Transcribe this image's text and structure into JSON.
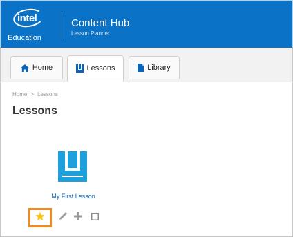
{
  "header": {
    "logo_word": "intel",
    "logo_sub": "Education",
    "app_title": "Content Hub",
    "app_subtitle": "Lesson Planner",
    "color": "#0a72c7"
  },
  "tabs": [
    {
      "label": "Home",
      "icon": "home-icon",
      "active": false
    },
    {
      "label": "Lessons",
      "icon": "book-icon",
      "active": true
    },
    {
      "label": "Library",
      "icon": "file-icon",
      "active": false
    }
  ],
  "breadcrumb": {
    "home": "Home",
    "separator": ">",
    "current": "Lessons"
  },
  "page": {
    "title": "Lessons"
  },
  "lesson": {
    "name": "My First Lesson",
    "icon": "book-icon",
    "actions": [
      "star-icon",
      "pencil-icon",
      "plus-icon",
      "checkbox-icon"
    ],
    "favorite_color": "#ffc20e",
    "highlight_color": "#f08a1e"
  }
}
